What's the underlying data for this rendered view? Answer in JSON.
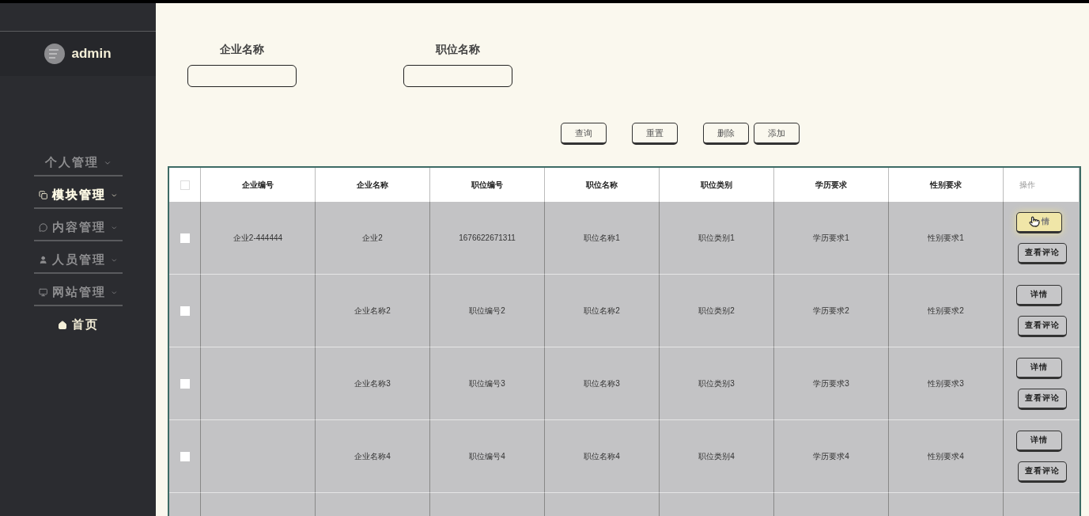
{
  "sidebar": {
    "user": "admin",
    "menu": [
      {
        "label": "个人管理",
        "selected": false,
        "dropdown": true
      },
      {
        "label": "模块管理",
        "selected": true,
        "dropdown": true
      },
      {
        "label": "内容管理",
        "selected": false,
        "dropdown": true
      },
      {
        "label": "人员管理",
        "selected": false,
        "dropdown": true
      },
      {
        "label": "网站管理",
        "selected": false,
        "dropdown": true
      },
      {
        "label": "首页",
        "selected": false,
        "dropdown": false
      }
    ]
  },
  "search": {
    "fields": [
      {
        "label": "企业名称"
      },
      {
        "label": "职位名称"
      }
    ],
    "buttons": [
      "查询",
      "重置",
      "删除",
      "添加"
    ]
  },
  "table": {
    "columns": [
      "企业编号",
      "企业名称",
      "职位编号",
      "职位名称",
      "职位类别",
      "学历要求",
      "性别要求",
      "操作"
    ],
    "header_checked": false,
    "rows": [
      {
        "checked": false,
        "cells": [
          "企业2-444444",
          "企业2",
          "1676622671311",
          "职位名称1",
          "职位类别1",
          "学历要求1",
          "性别要求1"
        ],
        "actions": [
          {
            "label": "情",
            "hovered": true
          },
          {
            "label": "查看评论",
            "hovered": false
          }
        ]
      },
      {
        "checked": false,
        "cells": [
          "",
          "企业名称2",
          "职位编号2",
          "职位名称2",
          "职位类别2",
          "学历要求2",
          "性别要求2"
        ],
        "actions": [
          {
            "label": "详情",
            "hovered": false
          },
          {
            "label": "查看评论",
            "hovered": false
          }
        ]
      },
      {
        "checked": false,
        "cells": [
          "",
          "企业名称3",
          "职位编号3",
          "职位名称3",
          "职位类别3",
          "学历要求3",
          "性别要求3"
        ],
        "actions": [
          {
            "label": "详情",
            "hovered": false
          },
          {
            "label": "查看评论",
            "hovered": false
          }
        ]
      },
      {
        "checked": false,
        "cells": [
          "",
          "企业名称4",
          "职位编号4",
          "职位名称4",
          "职位类别4",
          "学历要求4",
          "性别要求4"
        ],
        "actions": [
          {
            "label": "详情",
            "hovered": false
          },
          {
            "label": "查看评论",
            "hovered": false
          }
        ]
      }
    ]
  }
}
